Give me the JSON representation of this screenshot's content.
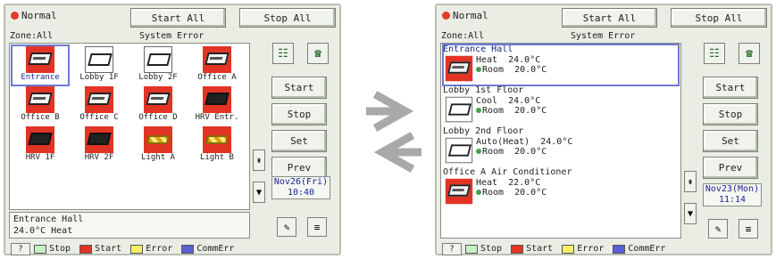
{
  "left": {
    "status": "Normal",
    "start_all": "Start All",
    "stop_all": "Stop All",
    "zone": "Zone:All",
    "system_error": "System Error",
    "units": [
      {
        "label": "Entrance",
        "icon": "cassette-icon",
        "style": "red",
        "selected": true
      },
      {
        "label": "Lobby 1F",
        "icon": "wall-unit-icon",
        "style": "white"
      },
      {
        "label": "Lobby 2F",
        "icon": "wall-unit-icon",
        "style": "white"
      },
      {
        "label": "Office A",
        "icon": "cassette-icon",
        "style": "red"
      },
      {
        "label": "Office B",
        "icon": "cassette-icon",
        "style": "red"
      },
      {
        "label": "Office C",
        "icon": "cassette-icon",
        "style": "red"
      },
      {
        "label": "Office D",
        "icon": "cassette-icon",
        "style": "red"
      },
      {
        "label": "HRV Entr.",
        "icon": "hrv-icon",
        "style": "red"
      },
      {
        "label": "HRV 1F",
        "icon": "hrv-icon",
        "style": "red"
      },
      {
        "label": "HRV 2F",
        "icon": "hrv-icon",
        "style": "red"
      },
      {
        "label": "Light A",
        "icon": "light-icon",
        "style": "red"
      },
      {
        "label": "Light B",
        "icon": "light-icon",
        "style": "red"
      }
    ],
    "info_line1": "Entrance Hall",
    "info_line2": "24.0°C  Heat",
    "buttons": {
      "start": "Start",
      "stop": "Stop",
      "set": "Set",
      "prev": "Prev"
    },
    "date": "Nov26(Fri)",
    "time": "10:40"
  },
  "right": {
    "status": "Normal",
    "start_all": "Start All",
    "stop_all": "Stop All",
    "zone": "Zone:All",
    "system_error": "System Error",
    "rows": [
      {
        "name": "Entrance Hall",
        "line1": "Heat  24.0°C",
        "line2": "Room  20.0°C",
        "icon": "cassette-icon",
        "style": "red",
        "selected": true
      },
      {
        "name": "Lobby 1st Floor",
        "line1": "Cool  24.0°C",
        "line2": "Room  20.0°C",
        "icon": "wall-unit-icon",
        "style": "white"
      },
      {
        "name": "Lobby 2nd Floor",
        "line1": "Auto(Heat)  24.0°C",
        "line2": "Room  20.0°C",
        "icon": "wall-unit-icon",
        "style": "white"
      },
      {
        "name": "Office A Air Conditioner",
        "line1": "Heat  22.0°C",
        "line2": "Room  20.0°C",
        "icon": "cassette-icon",
        "style": "red"
      }
    ],
    "buttons": {
      "start": "Start",
      "stop": "Stop",
      "set": "Set",
      "prev": "Prev"
    },
    "date": "Nov23(Mon)",
    "time": "11:14"
  },
  "legend": {
    "help": "?",
    "items": [
      {
        "label": "Stop",
        "color": "#c9f0c2"
      },
      {
        "label": "Start",
        "color": "#e23424"
      },
      {
        "label": "Error",
        "color": "#f4f06a"
      },
      {
        "label": "CommErr",
        "color": "#5a5fd8"
      }
    ]
  },
  "colors": {
    "unit_red": "#e23424",
    "selection": "#6c7ad1",
    "arrow": "#a9a9a9"
  }
}
